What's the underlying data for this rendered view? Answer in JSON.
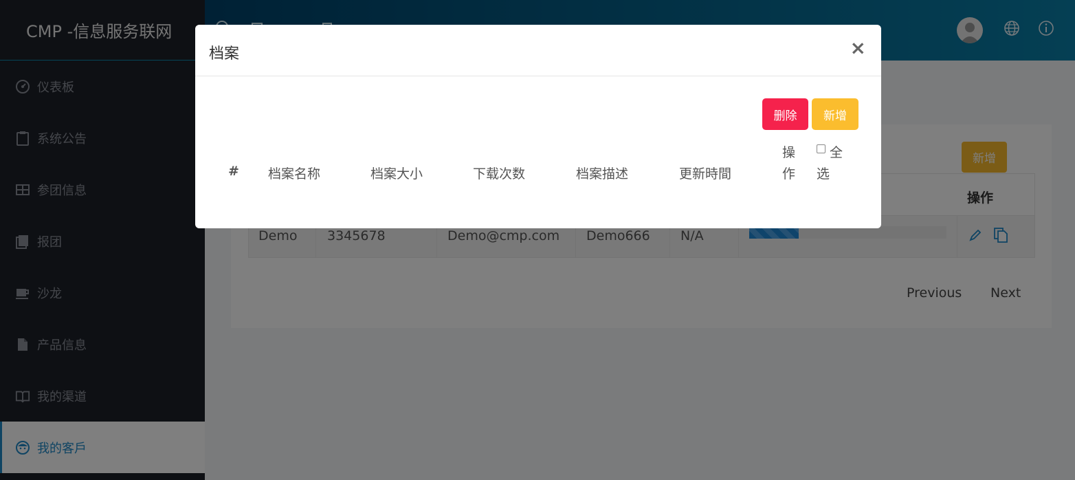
{
  "brand": "CMP -信息服务联网",
  "nav": [
    {
      "label": "仪表板",
      "icon": "dashboard-icon"
    },
    {
      "label": "系统公告",
      "icon": "clipboard-icon"
    },
    {
      "label": "参团信息",
      "icon": "table-icon"
    },
    {
      "label": "报团",
      "icon": "book-stack-icon"
    },
    {
      "label": "沙龙",
      "icon": "coffee-icon"
    },
    {
      "label": "产品信息",
      "icon": "file-icon"
    },
    {
      "label": "我的渠道",
      "icon": "open-book-icon"
    },
    {
      "label": "我的客戶",
      "icon": "customer-face-icon",
      "active": true
    }
  ],
  "header": {
    "icons": [
      "user-avatar",
      "globe-icon",
      "info-icon"
    ]
  },
  "background_card": {
    "add_label": "新增",
    "action_header": "操作",
    "row": {
      "name": "Demo",
      "phone": "3345678",
      "email": "Demo@cmp.com",
      "code": "Demo666",
      "status": "N/A",
      "progress": 0.25
    },
    "pager": {
      "previous": "Previous",
      "next": "Next"
    }
  },
  "modal": {
    "title": "档案",
    "close": "×",
    "delete_label": "删除",
    "add_label": "新增",
    "columns": [
      "#",
      "档案名称",
      "档案大小",
      "下载次数",
      "档案描述",
      "更新時間"
    ],
    "action_col": [
      "操",
      "作"
    ],
    "select_all": [
      "全",
      "选"
    ]
  },
  "colors": {
    "sidebar_bg": "#1d2028",
    "accent": "#1e88c7",
    "danger": "#f5224c",
    "warning": "#fbbd2e"
  }
}
